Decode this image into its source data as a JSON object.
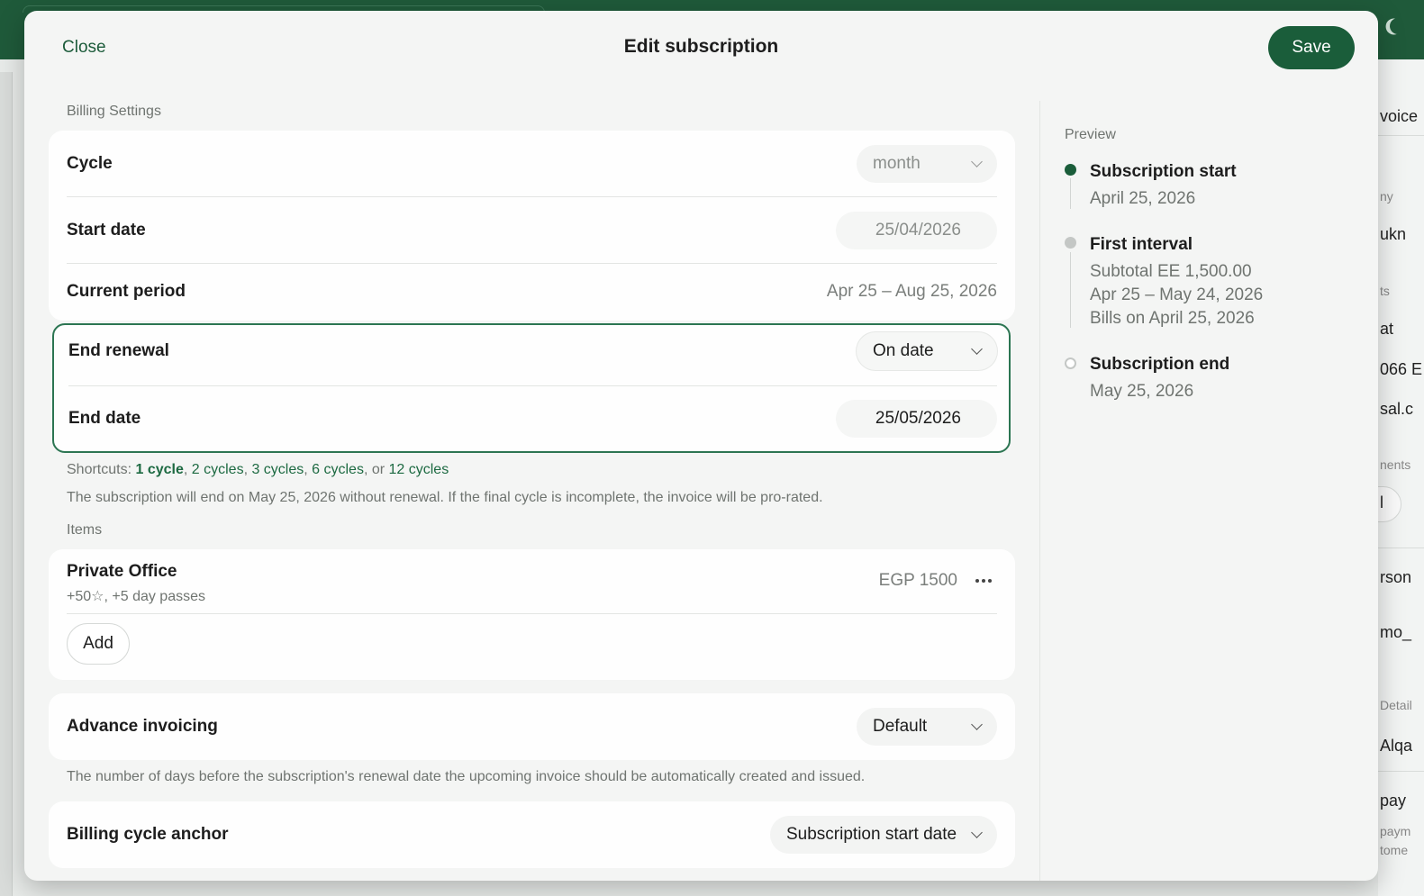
{
  "background": {
    "right_fragments": [
      "voice",
      "ny",
      "ukn",
      "ts",
      "at",
      "066 E",
      "sal.c",
      "nents",
      "l",
      "rson",
      "mo_",
      "Detail",
      "Alqa",
      "pay",
      "paym",
      "tome"
    ]
  },
  "modal": {
    "close_label": "Close",
    "title": "Edit subscription",
    "save_label": "Save"
  },
  "billing": {
    "section_label": "Billing Settings",
    "cycle": {
      "label": "Cycle",
      "value": "month"
    },
    "start_date": {
      "label": "Start date",
      "value": "25/04/2026"
    },
    "current_period": {
      "label": "Current period",
      "value": "Apr 25 – Aug 25, 2026"
    },
    "end_renewal": {
      "label": "End renewal",
      "value": "On date"
    },
    "end_date": {
      "label": "End date",
      "value": "25/05/2026"
    },
    "shortcuts": {
      "prefix": "Shortcuts: ",
      "options": [
        "1 cycle",
        "2 cycles",
        "3 cycles",
        "6 cycles",
        "12 cycles"
      ],
      "sep": ", ",
      "or": ", or "
    },
    "end_note": "The subscription will end on May 25, 2026 without renewal. If the final cycle is incomplete, the invoice will be pro-rated."
  },
  "items": {
    "section_label": "Items",
    "list": [
      {
        "name": "Private Office",
        "detail": "+50☆, +5 day passes",
        "price": "EGP 1500"
      }
    ],
    "add_label": "Add"
  },
  "advance_invoicing": {
    "label": "Advance invoicing",
    "value": "Default",
    "note": "The number of days before the subscription's renewal date the upcoming invoice should be automatically created and issued."
  },
  "billing_anchor": {
    "label": "Billing cycle anchor",
    "value": "Subscription start date"
  },
  "preview": {
    "label": "Preview",
    "start": {
      "title": "Subscription start",
      "date": "April 25, 2026"
    },
    "first_interval": {
      "title": "First interval",
      "subtotal": "Subtotal EE 1,500.00",
      "range": "Apr 25 – May 24, 2026",
      "bills": "Bills on April 25, 2026"
    },
    "end": {
      "title": "Subscription end",
      "date": "May 25, 2026"
    }
  },
  "colors": {
    "brand_green": "#1a5d3a",
    "link_green": "#1d6a42",
    "dot_gray": "#c4c7c5"
  }
}
